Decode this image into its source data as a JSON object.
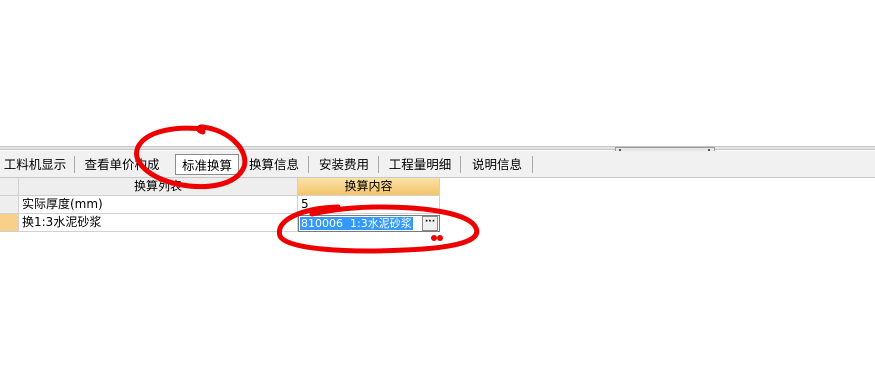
{
  "tabs": [
    {
      "label": "工料机显示"
    },
    {
      "label": "查看单价构成"
    },
    {
      "label": "标准换算"
    },
    {
      "label": "换算信息"
    },
    {
      "label": "安装费用"
    },
    {
      "label": "工程量明细"
    },
    {
      "label": "说明信息"
    }
  ],
  "active_tab": "标准换算",
  "grid": {
    "columns": [
      "换算列表",
      "换算内容"
    ],
    "rows": [
      {
        "list": "实际厚度(mm)",
        "content": "5"
      },
      {
        "list": "换1:3水泥砂浆",
        "content": "810006  1:3水泥砂浆"
      }
    ]
  },
  "editor_button": "···",
  "colors": {
    "annotation": "#ee0000",
    "selection": "#3399ff",
    "selected_header": "#f4c46a"
  }
}
